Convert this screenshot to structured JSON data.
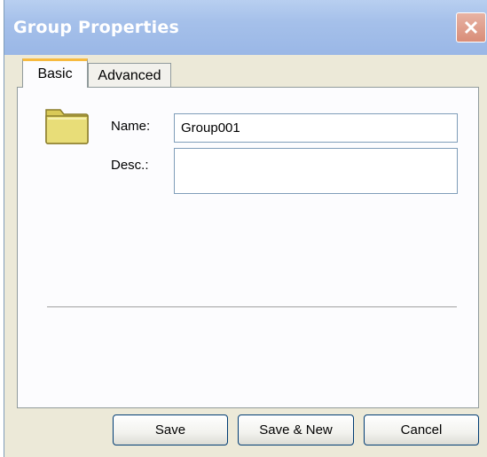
{
  "window": {
    "title": "Group Properties"
  },
  "tabs": [
    {
      "label": "Basic",
      "active": true
    },
    {
      "label": "Advanced",
      "active": false
    }
  ],
  "form": {
    "name_label": "Name:",
    "name_value": "Group001",
    "desc_label": "Desc.:",
    "desc_value": ""
  },
  "buttons": {
    "save": "Save",
    "save_new": "Save & New",
    "cancel": "Cancel"
  },
  "icons": {
    "group": "folder-icon",
    "close": "close-icon"
  },
  "colors": {
    "titlebar": "#a5c0ea",
    "dialog_bg": "#ece9d8",
    "tab_highlight": "#f7ba3f"
  }
}
